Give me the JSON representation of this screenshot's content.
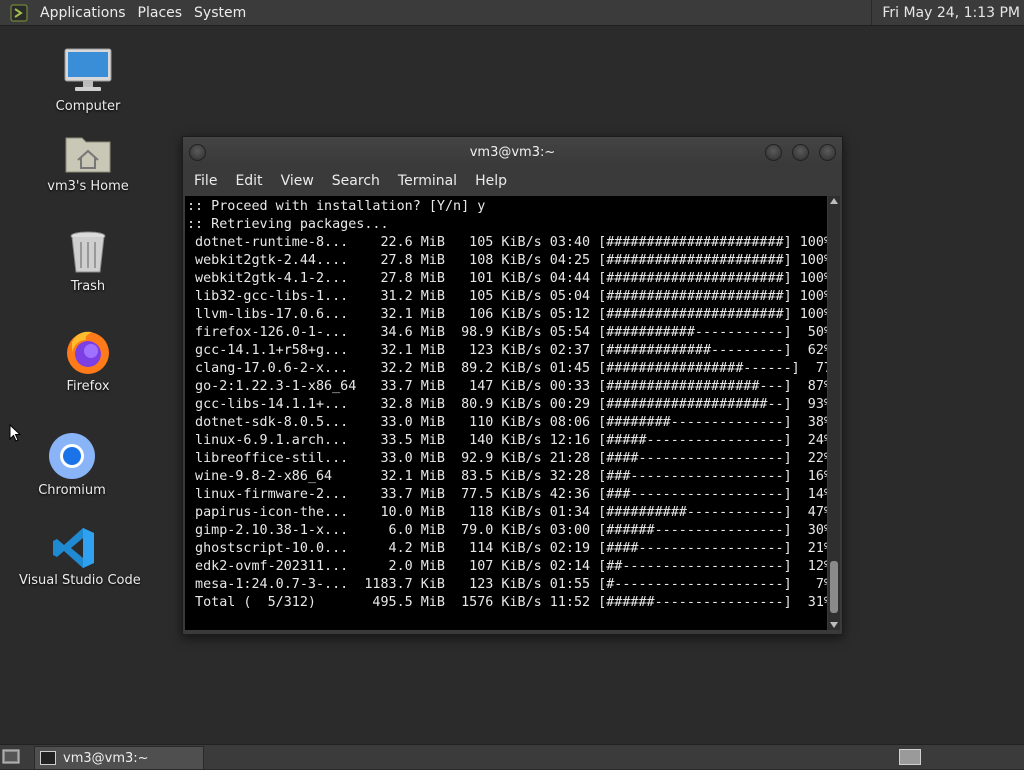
{
  "top_panel": {
    "menus": [
      "Applications",
      "Places",
      "System"
    ],
    "clock": "Fri May 24,  1:13 PM"
  },
  "desktop_icons": [
    {
      "label": "Computer",
      "icon": "computer-icon"
    },
    {
      "label": "vm3's Home",
      "icon": "home-folder-icon"
    },
    {
      "label": "Trash",
      "icon": "trash-icon"
    },
    {
      "label": "Firefox",
      "icon": "firefox-icon"
    },
    {
      "label": "Chromium",
      "icon": "chromium-icon"
    },
    {
      "label": "Visual Studio Code",
      "icon": "vscode-icon"
    }
  ],
  "window": {
    "title": "vm3@vm3:~",
    "menu": [
      "File",
      "Edit",
      "View",
      "Search",
      "Terminal",
      "Help"
    ]
  },
  "terminal": {
    "lines": [
      ":: Proceed with installation? [Y/n] y",
      ":: Retrieving packages...",
      " dotnet-runtime-8...    22.6 MiB   105 KiB/s 03:40 [######################] 100%",
      " webkit2gtk-2.44....    27.8 MiB   108 KiB/s 04:25 [######################] 100%",
      " webkit2gtk-4.1-2...    27.8 MiB   101 KiB/s 04:44 [######################] 100%",
      " lib32-gcc-libs-1...    31.2 MiB   105 KiB/s 05:04 [######################] 100%",
      " llvm-libs-17.0.6...    32.1 MiB   106 KiB/s 05:12 [######################] 100%",
      " firefox-126.0-1-...    34.6 MiB  98.9 KiB/s 05:54 [###########-----------]  50%",
      " gcc-14.1.1+r58+g...    32.1 MiB   123 KiB/s 02:37 [#############---------]  62%",
      " clang-17.0.6-2-x...    32.2 MiB  89.2 KiB/s 01:45 [#################------]  77%",
      " go-2:1.22.3-1-x86_64   33.7 MiB   147 KiB/s 00:33 [###################---]  87%",
      " gcc-libs-14.1.1+...    32.8 MiB  80.9 KiB/s 00:29 [####################--]  93%",
      " dotnet-sdk-8.0.5...    33.0 MiB   110 KiB/s 08:06 [########--------------]  38%",
      " linux-6.9.1.arch...    33.5 MiB   140 KiB/s 12:16 [#####-----------------]  24%",
      " libreoffice-stil...    33.0 MiB  92.9 KiB/s 21:28 [####------------------]  22%",
      " wine-9.8-2-x86_64      32.1 MiB  83.5 KiB/s 32:28 [###-------------------]  16%",
      " linux-firmware-2...    33.7 MiB  77.5 KiB/s 42:36 [###-------------------]  14%",
      " papirus-icon-the...    10.0 MiB   118 KiB/s 01:34 [##########------------]  47%",
      " gimp-2.10.38-1-x...     6.0 MiB  79.0 KiB/s 03:00 [######----------------]  30%",
      " ghostscript-10.0...     4.2 MiB   114 KiB/s 02:19 [####------------------]  21%",
      " edk2-ovmf-202311...     2.0 MiB   107 KiB/s 02:14 [##--------------------]  12%",
      " mesa-1:24.0.7-3-...  1183.7 KiB   123 KiB/s 01:55 [#---------------------]   7%",
      " Total (  5/312)       495.5 MiB  1576 KiB/s 11:52 [######----------------]  31%"
    ]
  },
  "taskbar": {
    "task_label": "vm3@vm3:~"
  }
}
